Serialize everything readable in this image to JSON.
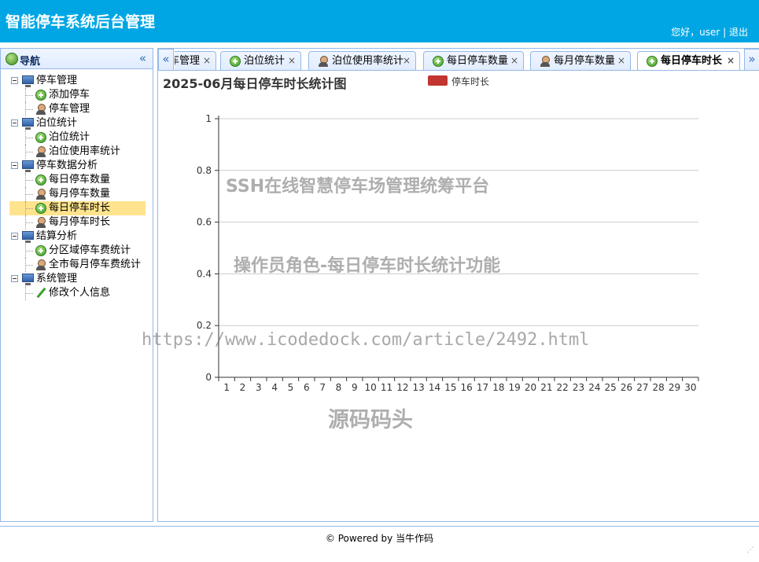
{
  "header": {
    "title": "智能停车系统后台管理",
    "greeting": "您好，user",
    "separator": "|",
    "logout": "退出"
  },
  "sidebar": {
    "title": "导航",
    "collapse_glyph": "«",
    "groups": [
      {
        "label": "停车管理",
        "items": [
          {
            "label": "添加停车",
            "icon": "add-icon"
          },
          {
            "label": "停车管理",
            "icon": "user-icon"
          }
        ]
      },
      {
        "label": "泊位统计",
        "items": [
          {
            "label": "泊位统计",
            "icon": "add-icon"
          },
          {
            "label": "泊位使用率统计",
            "icon": "user-icon"
          }
        ]
      },
      {
        "label": "停车数据分析",
        "items": [
          {
            "label": "每日停车数量",
            "icon": "add-icon"
          },
          {
            "label": "每月停车数量",
            "icon": "user-icon"
          },
          {
            "label": "每日停车时长",
            "icon": "add-icon",
            "selected": true
          },
          {
            "label": "每月停车时长",
            "icon": "user-icon"
          }
        ]
      },
      {
        "label": "结算分析",
        "items": [
          {
            "label": "分区域停车费统计",
            "icon": "add-icon"
          },
          {
            "label": "全市每月停车费统计",
            "icon": "user-icon"
          }
        ]
      },
      {
        "label": "系统管理",
        "items": [
          {
            "label": "修改个人信息",
            "icon": "pencil-icon"
          }
        ]
      }
    ]
  },
  "tabs": {
    "scroll_left": "«",
    "scroll_right": "»",
    "items": [
      {
        "label": "停车管理",
        "icon": "user-icon",
        "partial": true
      },
      {
        "label": "泊位统计",
        "icon": "add-icon"
      },
      {
        "label": "泊位使用率统计",
        "icon": "user-icon"
      },
      {
        "label": "每日停车数量",
        "icon": "add-icon"
      },
      {
        "label": "每月停车数量",
        "icon": "user-icon"
      },
      {
        "label": "每日停车时长",
        "icon": "add-icon",
        "active": true
      }
    ],
    "close_glyph": "×"
  },
  "chart_data": {
    "type": "bar",
    "title": "2025-06月每日停车时长统计图",
    "xlabel": "",
    "ylabel": "",
    "categories": [
      "1",
      "2",
      "3",
      "4",
      "5",
      "6",
      "7",
      "8",
      "9",
      "10",
      "11",
      "12",
      "13",
      "14",
      "15",
      "16",
      "17",
      "18",
      "19",
      "20",
      "21",
      "22",
      "23",
      "24",
      "25",
      "26",
      "27",
      "28",
      "29",
      "30"
    ],
    "series": [
      {
        "name": "停车时长",
        "color": "#c23531",
        "values": [
          0,
          0,
          0,
          0,
          0,
          0,
          0,
          0,
          0,
          0,
          0,
          0,
          0,
          0,
          0,
          0,
          0,
          0,
          0,
          0,
          0,
          0,
          0,
          0,
          0,
          0,
          0,
          0,
          0,
          0
        ]
      }
    ],
    "ylim": [
      0,
      1
    ],
    "yticks": [
      "0",
      "0.2",
      "0.4",
      "0.6",
      "0.8",
      "1"
    ],
    "grid": true,
    "legend": "top-center"
  },
  "watermarks": [
    "SSH在线智慧停车场管理统筹平台",
    "操作员角色-每日停车时长统计功能",
    "https://www.icodedock.com/article/2492.html",
    "源码码头"
  ],
  "footer": {
    "text": "© Powered by 当牛作码"
  }
}
